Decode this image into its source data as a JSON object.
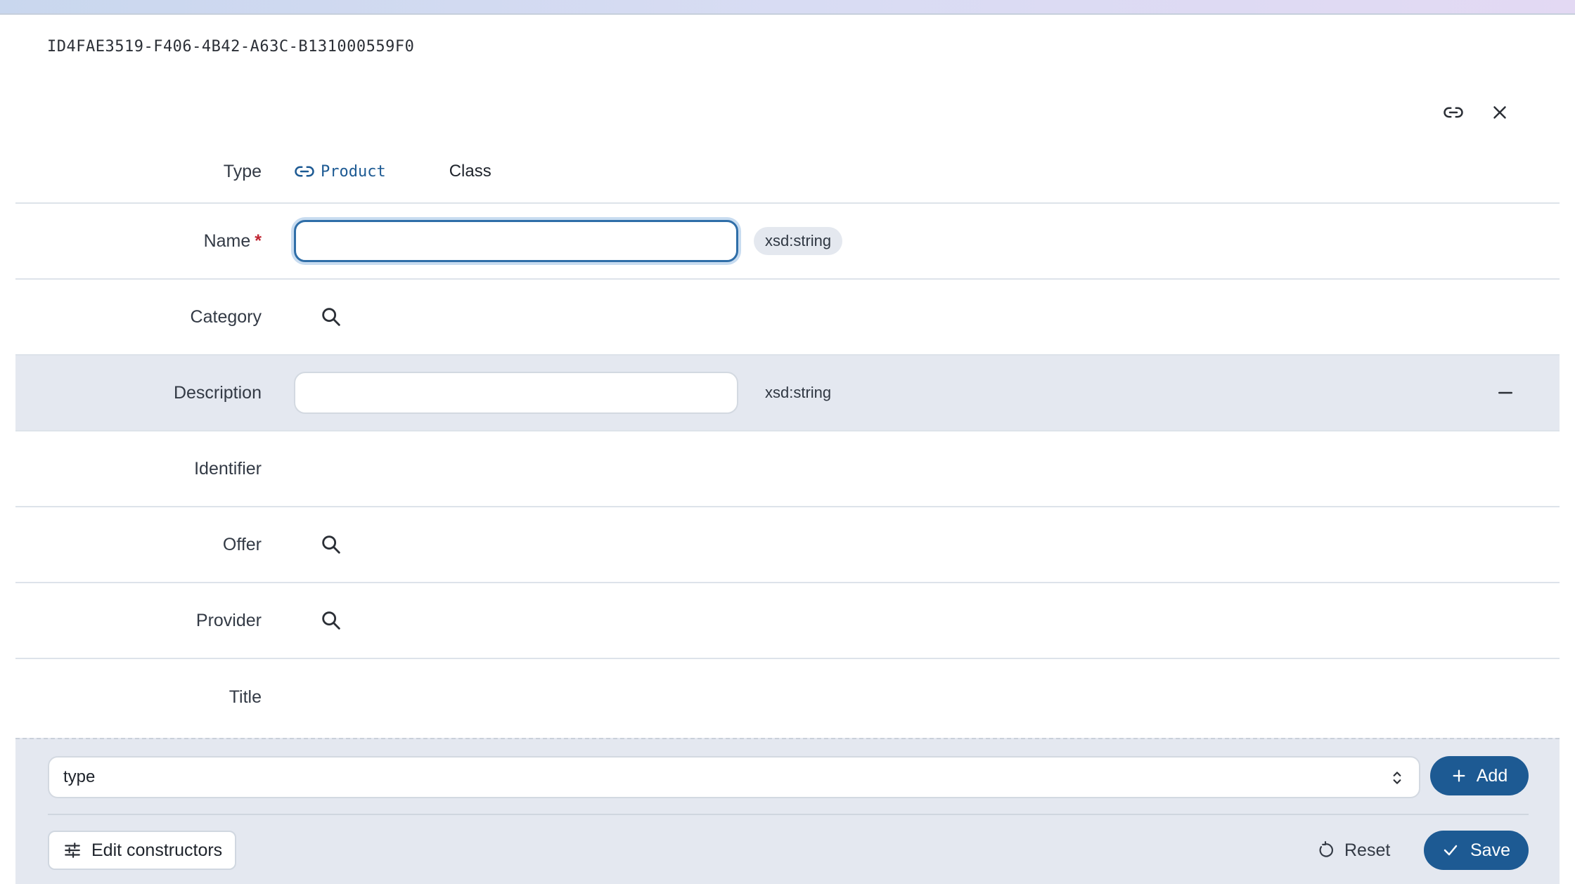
{
  "document": {
    "id": "ID4FAE3519-F406-4B42-A63C-B131000559F0"
  },
  "top_actions": {
    "link_icon": "link-icon",
    "close_icon": "close-icon"
  },
  "type_row": {
    "label": "Type",
    "type_name": "Product",
    "class_label": "Class"
  },
  "fields": {
    "name": {
      "label": "Name",
      "required_mark": "*",
      "value": "",
      "datatype": "xsd:string"
    },
    "category": {
      "label": "Category"
    },
    "description": {
      "label": "Description",
      "value": "",
      "datatype": "xsd:string"
    },
    "identifier": {
      "label": "Identifier"
    },
    "offer": {
      "label": "Offer"
    },
    "provider": {
      "label": "Provider"
    },
    "title": {
      "label": "Title"
    }
  },
  "add_property": {
    "selected": "type",
    "add_label": "Add"
  },
  "footer": {
    "edit_constructors_label": "Edit constructors",
    "reset_label": "Reset",
    "save_label": "Save"
  },
  "colors": {
    "accent": "#1d5a93",
    "highlight_row": "#e4e8f0",
    "required": "#c02633"
  }
}
